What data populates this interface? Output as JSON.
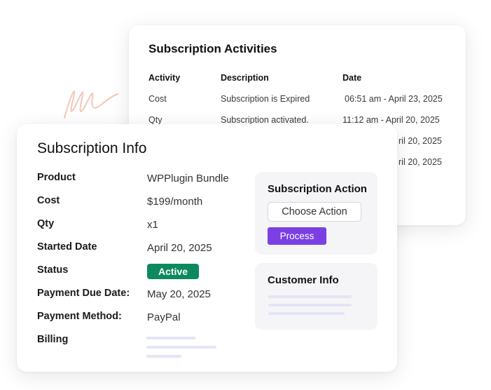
{
  "activities": {
    "title": "Subscription Activities",
    "columns": [
      "Activity",
      "Description",
      "Date"
    ],
    "rows": [
      {
        "activity": "Cost",
        "description": "Subscription is Expired",
        "date": "06:51 am - April 23, 2025"
      },
      {
        "activity": "Qty",
        "description": "Subscription activated.",
        "date": "11:12 am - April 20, 2025"
      },
      {
        "activity": "",
        "description": "",
        "date": "ril 20, 2025"
      },
      {
        "activity": "",
        "description": "",
        "date": "ril 20, 2025"
      }
    ]
  },
  "info": {
    "title": "Subscription Info",
    "fields": [
      {
        "label": "Product",
        "value": "WPPlugin Bundle"
      },
      {
        "label": "Cost",
        "value": "$199/month"
      },
      {
        "label": "Qty",
        "value": "x1"
      },
      {
        "label": "Started Date",
        "value": "April 20, 2025"
      },
      {
        "label": "Status",
        "value": "Active"
      },
      {
        "label": "Payment Due Date:",
        "value": "May 20, 2025"
      },
      {
        "label": "Payment Method:",
        "value": "PayPal"
      },
      {
        "label": "Billing",
        "value": ""
      }
    ]
  },
  "action_panel": {
    "title": "Subscription Action",
    "select_label": "Choose Action",
    "process_label": "Process"
  },
  "customer_panel": {
    "title": "Customer Info"
  },
  "colors": {
    "status_active": "#0d8a5d",
    "process_button": "#7b3fe4",
    "placeholder_line": "#e4e4f8",
    "panel_bg": "#f5f5f7"
  }
}
